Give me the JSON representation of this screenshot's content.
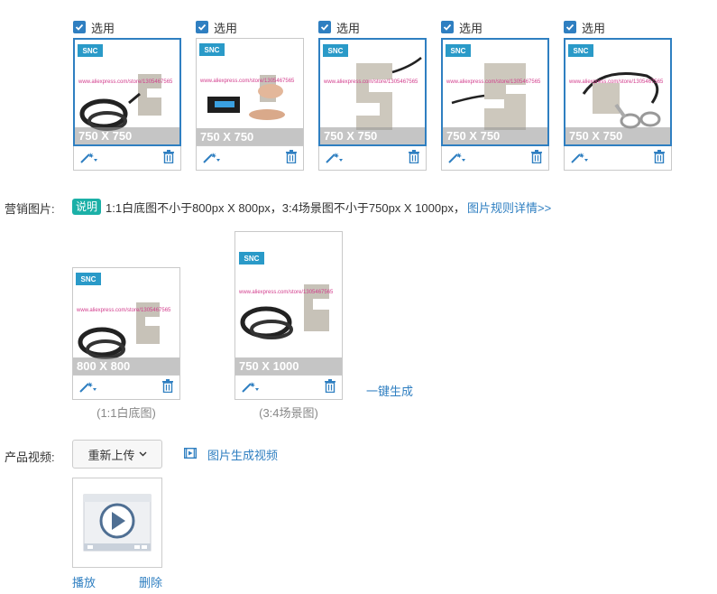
{
  "product_images": [
    {
      "select_label": "选用",
      "size": "750 X 750",
      "brand": "SNC",
      "watermark": "www.aliexpress.com/store/1305467565"
    },
    {
      "select_label": "选用",
      "size": "750 X 750",
      "brand": "SNC",
      "watermark": "www.aliexpress.com/store/1305467565"
    },
    {
      "select_label": "选用",
      "size": "750 X 750",
      "brand": "SNC",
      "watermark": "www.aliexpress.com/store/1305467565"
    },
    {
      "select_label": "选用",
      "size": "750 X 750",
      "brand": "SNC",
      "watermark": "www.aliexpress.com/store/1305467565"
    },
    {
      "select_label": "选用",
      "size": "750 X 750",
      "brand": "SNC",
      "watermark": "www.aliexpress.com/store/1305467565"
    }
  ],
  "marketing": {
    "label": "营销图片:",
    "badge": "说明",
    "description": "1:1白底图不小于800px X 800px，3:4场景图不小于750px X 1000px，",
    "rules_link": "图片规则详情>>",
    "images": [
      {
        "size": "800 X 800",
        "caption": "(1:1白底图)",
        "brand": "SNC",
        "watermark": "www.aliexpress.com/store/1305467565"
      },
      {
        "size": "750 X 1000",
        "caption": "(3:4场景图)",
        "brand": "SNC",
        "watermark": "www.aliexpress.com/store/1305467565"
      }
    ],
    "generate_link": "一键生成"
  },
  "video": {
    "label": "产品视频:",
    "reupload_button": "重新上传",
    "generate_link": "图片生成视频",
    "play_link": "播放",
    "delete_link": "删除"
  },
  "colors": {
    "accent": "#2f7fc1",
    "badge": "#1bb0a7",
    "brand": "#2a9ac8"
  }
}
